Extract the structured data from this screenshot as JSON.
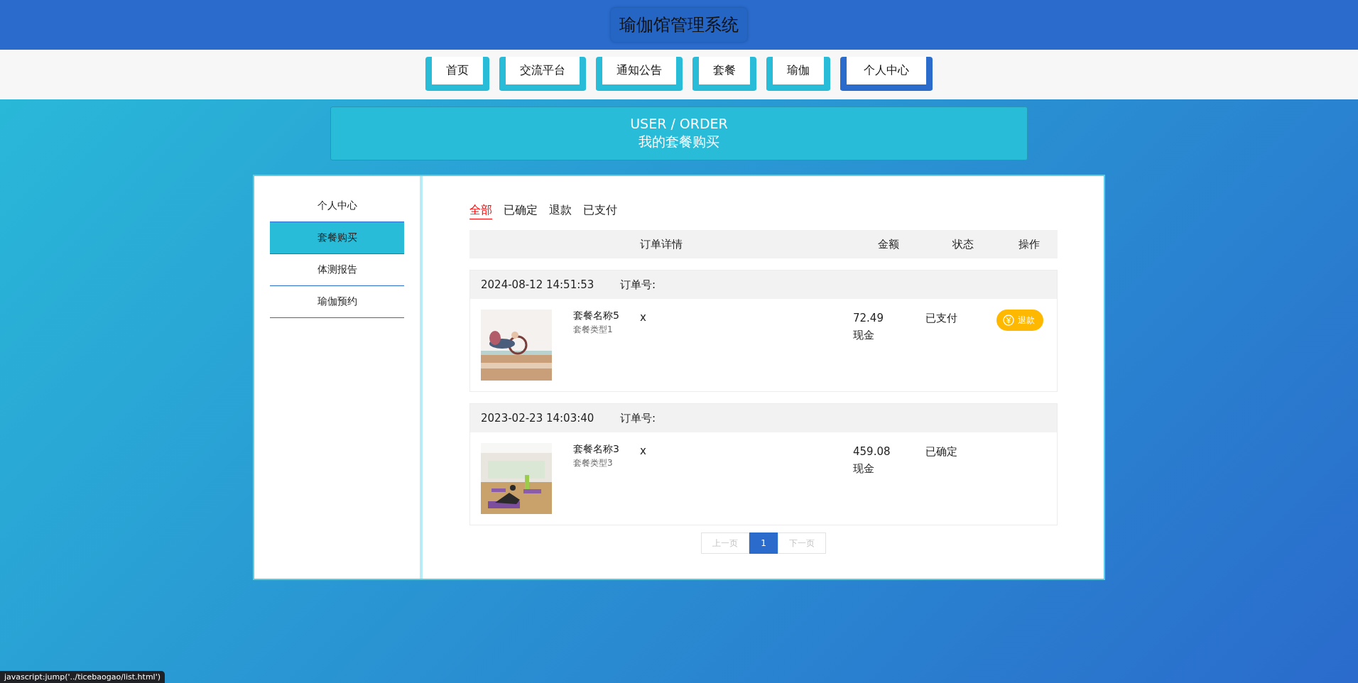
{
  "header": {
    "title": "瑜伽馆管理系统"
  },
  "nav": [
    {
      "label": "首页",
      "selected": false
    },
    {
      "label": "交流平台",
      "selected": false
    },
    {
      "label": "通知公告",
      "selected": false
    },
    {
      "label": "套餐",
      "selected": false
    },
    {
      "label": "瑜伽",
      "selected": false
    },
    {
      "label": "个人中心",
      "selected": true
    }
  ],
  "banner": {
    "subtitle": "USER / ORDER",
    "title": "我的套餐购买"
  },
  "sidebar": {
    "items": [
      {
        "label": "个人中心",
        "selected": false
      },
      {
        "label": "套餐购买",
        "selected": true
      },
      {
        "label": "体测报告",
        "selected": false
      },
      {
        "label": "瑜伽预约",
        "selected": false
      }
    ]
  },
  "filter_tabs": [
    {
      "label": "全部",
      "selected": true
    },
    {
      "label": "已确定",
      "selected": false
    },
    {
      "label": "退款",
      "selected": false
    },
    {
      "label": "已支付",
      "selected": false
    }
  ],
  "table": {
    "columns": [
      "订单详情",
      "金额",
      "状态",
      "操作"
    ],
    "orders": [
      {
        "time": "2024-08-12 14:51:53",
        "order_no_label": "订单号:",
        "name": "套餐名称5",
        "type": "套餐类型1",
        "quantity": "x",
        "amount": "72.49",
        "payment": "现金",
        "status": "已支付",
        "action": "退款"
      },
      {
        "time": "2023-02-23 14:03:40",
        "order_no_label": "订单号:",
        "name": "套餐名称3",
        "type": "套餐类型3",
        "quantity": "x",
        "amount": "459.08",
        "payment": "现金",
        "status": "已确定"
      }
    ]
  },
  "pagination": [
    {
      "label": "上一页",
      "selected": false,
      "disabled": true
    },
    {
      "label": "1",
      "selected": true,
      "disabled": false
    },
    {
      "label": "下一页",
      "selected": false,
      "disabled": true
    }
  ],
  "status_bar": {
    "text": "javascript:jump('../ticebaogao/list.html')"
  }
}
